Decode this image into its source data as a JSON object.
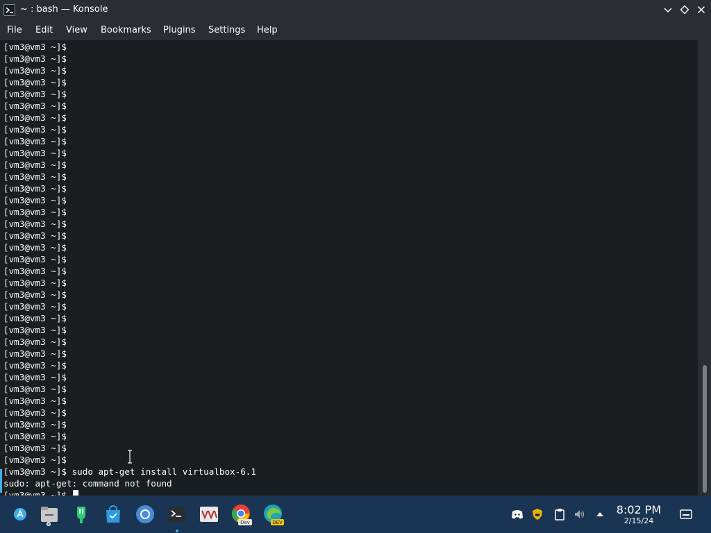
{
  "window": {
    "title": "~ : bash — Konsole"
  },
  "menu": {
    "items": [
      "File",
      "Edit",
      "View",
      "Bookmarks",
      "Plugins",
      "Settings",
      "Help"
    ]
  },
  "terminal": {
    "lines": [
      "[vm3@vm3 ~]$",
      "[vm3@vm3 ~]$",
      "[vm3@vm3 ~]$",
      "[vm3@vm3 ~]$",
      "[vm3@vm3 ~]$",
      "[vm3@vm3 ~]$",
      "[vm3@vm3 ~]$",
      "[vm3@vm3 ~]$",
      "[vm3@vm3 ~]$",
      "[vm3@vm3 ~]$",
      "[vm3@vm3 ~]$",
      "[vm3@vm3 ~]$",
      "[vm3@vm3 ~]$",
      "[vm3@vm3 ~]$",
      "[vm3@vm3 ~]$",
      "[vm3@vm3 ~]$",
      "[vm3@vm3 ~]$",
      "[vm3@vm3 ~]$",
      "[vm3@vm3 ~]$",
      "[vm3@vm3 ~]$",
      "[vm3@vm3 ~]$",
      "[vm3@vm3 ~]$",
      "[vm3@vm3 ~]$",
      "[vm3@vm3 ~]$",
      "[vm3@vm3 ~]$",
      "[vm3@vm3 ~]$",
      "[vm3@vm3 ~]$",
      "[vm3@vm3 ~]$",
      "[vm3@vm3 ~]$",
      "[vm3@vm3 ~]$",
      "[vm3@vm3 ~]$",
      "[vm3@vm3 ~]$",
      "[vm3@vm3 ~]$",
      "[vm3@vm3 ~]$",
      "[vm3@vm3 ~]$",
      "[vm3@vm3 ~]$",
      "[vm3@vm3 ~]$ sudo apt-get install virtualbox-6.1",
      "sudo: apt-get: command not found"
    ],
    "prompt": "[vm3@vm3 ~]$ "
  },
  "taskbar": {
    "apps": [
      {
        "name": "app-launcher",
        "icon": "app-launcher-icon"
      },
      {
        "name": "file-manager",
        "icon": "file-manager-icon"
      },
      {
        "name": "hardware-tool",
        "icon": "hardware-tool-icon"
      },
      {
        "name": "discover-store",
        "icon": "discover-store-icon"
      },
      {
        "name": "chromium",
        "icon": "chromium-icon"
      },
      {
        "name": "konsole",
        "icon": "konsole-icon"
      },
      {
        "name": "vivaldi",
        "icon": "vivaldi-icon"
      },
      {
        "name": "chrome-dev",
        "icon": "chrome-dev-icon",
        "badge": "Dev"
      },
      {
        "name": "edge-dev",
        "icon": "edge-dev-icon",
        "badge": "DEV"
      }
    ],
    "tray": [
      "discord-icon",
      "shield-icon",
      "clipboard-icon",
      "volume-icon",
      "expand-tray-icon"
    ],
    "clock": {
      "time": "8:02 PM",
      "date": "2/15/24"
    }
  },
  "colors": {
    "titlebar": "#2a2e32",
    "terminal_bg": "#1b1e20",
    "terminal_fg": "#fcfcfc",
    "accent": "#3daee9",
    "taskbar": "#1a3553"
  }
}
